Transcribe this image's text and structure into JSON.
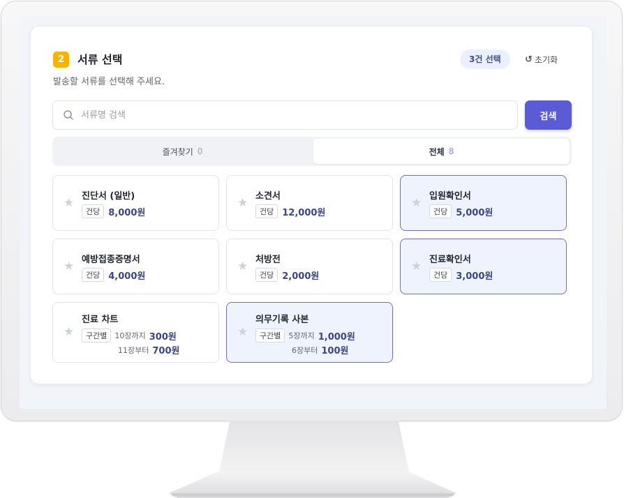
{
  "section": {
    "step": "2",
    "title": "서류 선택",
    "subtitle": "발송할 서류를 선택해 주세요.",
    "selected_count": "3건 선택",
    "reset_label": "초기화"
  },
  "search": {
    "placeholder": "서류명 검색",
    "value": "",
    "button_label": "검색"
  },
  "tabs": [
    {
      "label": "즐겨찾기",
      "count": "0",
      "active": false
    },
    {
      "label": "전체",
      "count": "8",
      "active": true
    }
  ],
  "documents": [
    {
      "name": "진단서 (일반)",
      "badge": "건당",
      "price": "8,000원",
      "selected": false
    },
    {
      "name": "소견서",
      "badge": "건당",
      "price": "12,000원",
      "selected": false
    },
    {
      "name": "입원확인서",
      "badge": "건당",
      "price": "5,000원",
      "selected": true
    },
    {
      "name": "예방접종증명서",
      "badge": "건당",
      "price": "4,000원",
      "selected": false
    },
    {
      "name": "처방전",
      "badge": "건당",
      "price": "2,000원",
      "selected": false
    },
    {
      "name": "진료확인서",
      "badge": "건당",
      "price": "3,000원",
      "selected": true
    },
    {
      "name": "진료 차트",
      "badge": "구간별",
      "tiers": [
        {
          "label": "10장까지",
          "price": "300원"
        },
        {
          "label": "11장부터",
          "price": "700원"
        }
      ],
      "selected": false
    },
    {
      "name": "의무기록 사본",
      "badge": "구간별",
      "tiers": [
        {
          "label": "5장까지",
          "price": "1,000원"
        },
        {
          "label": "6장부터",
          "price": "100원"
        }
      ],
      "selected": true
    }
  ],
  "colors": {
    "accent": "#5b5bd6",
    "step_badge": "#f5b400",
    "selected_card_bg": "#eff3fd",
    "selected_card_border": "#6a6fd2",
    "price_text": "#3a4685"
  },
  "icons": {
    "search": "search-icon",
    "reset": "reset-icon",
    "favorite": "star-icon"
  }
}
